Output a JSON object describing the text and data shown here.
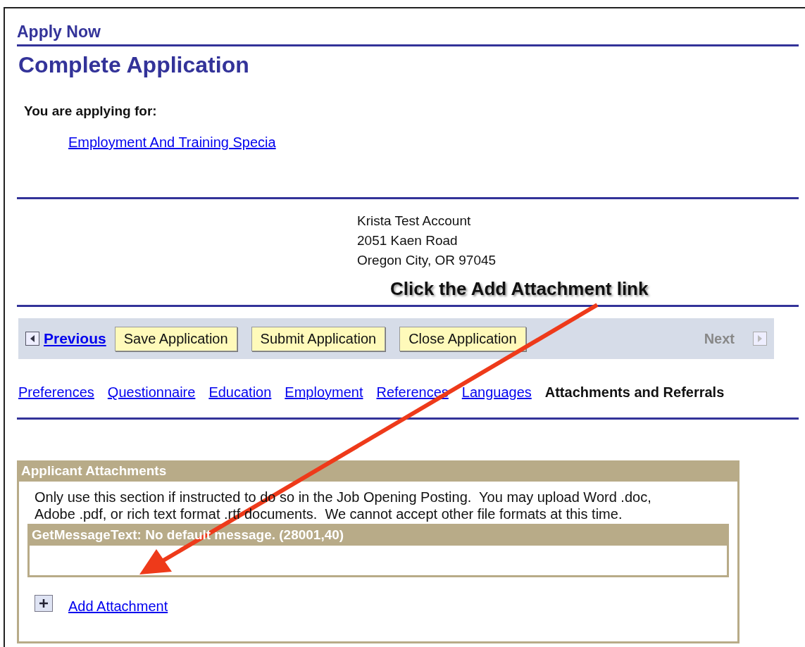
{
  "header": {
    "breadcrumb": "Apply Now",
    "title": "Complete Application"
  },
  "applying_for": {
    "label": "You are applying for:",
    "job_link": "Employment And Training Specia"
  },
  "address": [
    "Krista Test Account",
    "2051 Kaen Road",
    "Oregon City, OR 97045"
  ],
  "annotation": {
    "callout": "Click the Add Attachment link"
  },
  "nav": {
    "previous": "Previous",
    "buttons": [
      "Save Application",
      "Submit Application",
      "Close Application"
    ],
    "next": {
      "label": "Next",
      "disabled": true
    }
  },
  "tabs": [
    {
      "label": "Preferences",
      "selected": false
    },
    {
      "label": "Questionnaire",
      "selected": false
    },
    {
      "label": "Education",
      "selected": false
    },
    {
      "label": "Employment",
      "selected": false
    },
    {
      "label": "References",
      "selected": false
    },
    {
      "label": "Languages",
      "selected": false
    },
    {
      "label": "Attachments and Referrals",
      "selected": true
    }
  ],
  "attachments": {
    "title": "Applicant Attachments",
    "instructions": "Only use this section if instructed to do so in the Job Opening Posting.  You may upload Word .doc, Adobe .pdf, or rich text format .rtf documents.  We cannot accept other file formats at this time.",
    "grid": {
      "header": "GetMessageText: No default message. (28001,40)"
    },
    "add_link": "Add Attachment"
  }
}
